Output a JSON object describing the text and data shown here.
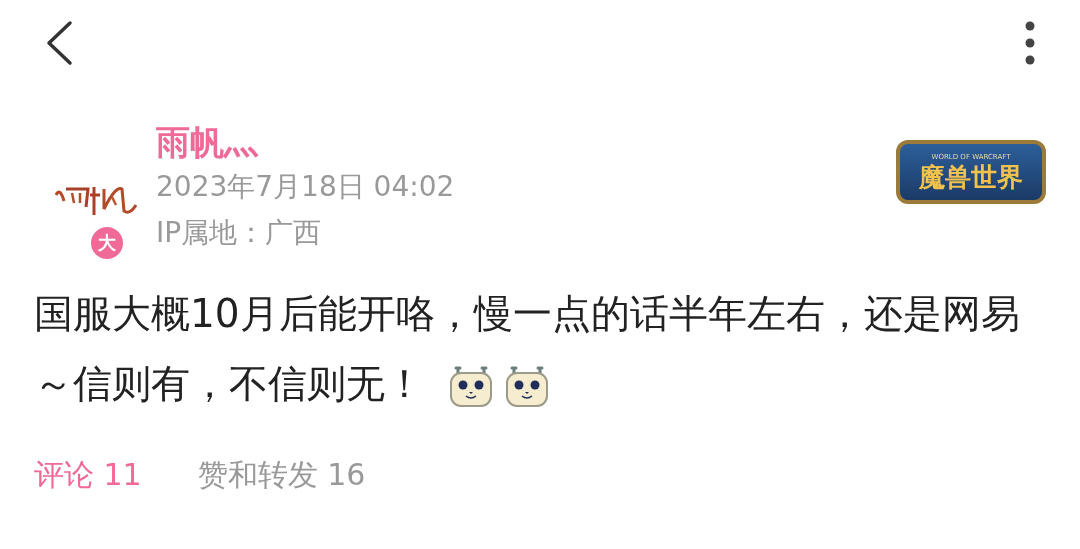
{
  "author": {
    "name": "雨帆灬",
    "level_badge": "大",
    "date": "2023年7月18日 04:02",
    "ip": "IP属地：广西"
  },
  "game_badge": {
    "subtitle": "WORLD OF WARCRAFT",
    "title": "魔兽世界"
  },
  "post": {
    "text": "国服大概10月后能开咯，慢一点的话半年左右，还是网易～信则有，不信则无！",
    "stickers": [
      {
        "kind": "sticker"
      },
      {
        "kind": "sticker"
      }
    ]
  },
  "tabs": [
    {
      "label": "评论 11",
      "selected": true
    },
    {
      "label": "赞和转发 16",
      "selected": false
    }
  ]
}
